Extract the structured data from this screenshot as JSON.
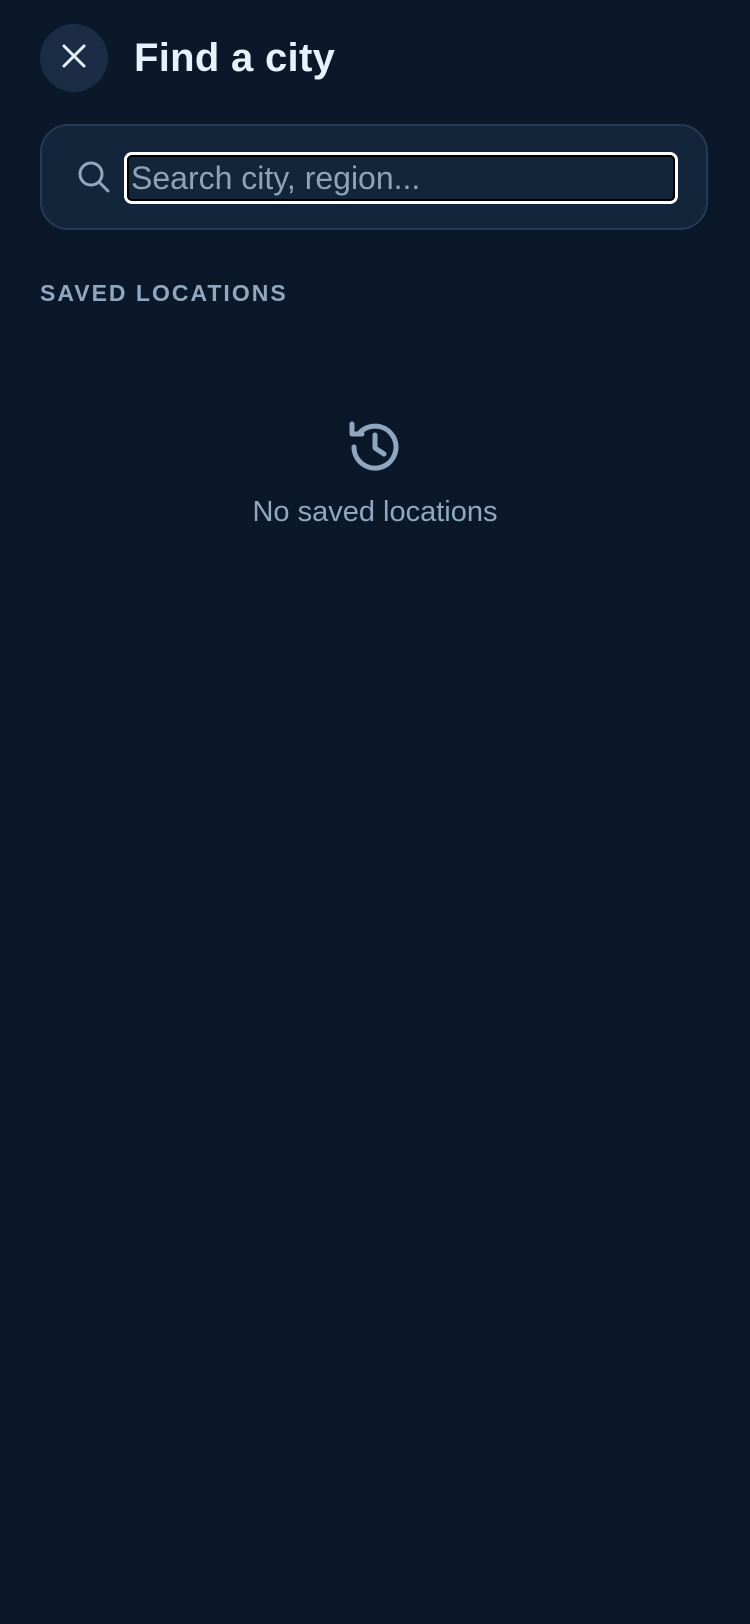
{
  "header": {
    "title": "Find a city",
    "close_icon": "close-icon"
  },
  "search": {
    "placeholder": "Search city, region...",
    "value": "",
    "icon": "search-icon"
  },
  "saved_locations": {
    "section_label": "SAVED LOCATIONS",
    "items": [],
    "empty_icon": "history-icon",
    "empty_text": "No saved locations"
  },
  "colors": {
    "background": "#0a1829",
    "surface": "#12253b",
    "button_bg": "#1a2d45",
    "title_text": "#e6f3ff",
    "muted_text": "#8fa8c0"
  }
}
